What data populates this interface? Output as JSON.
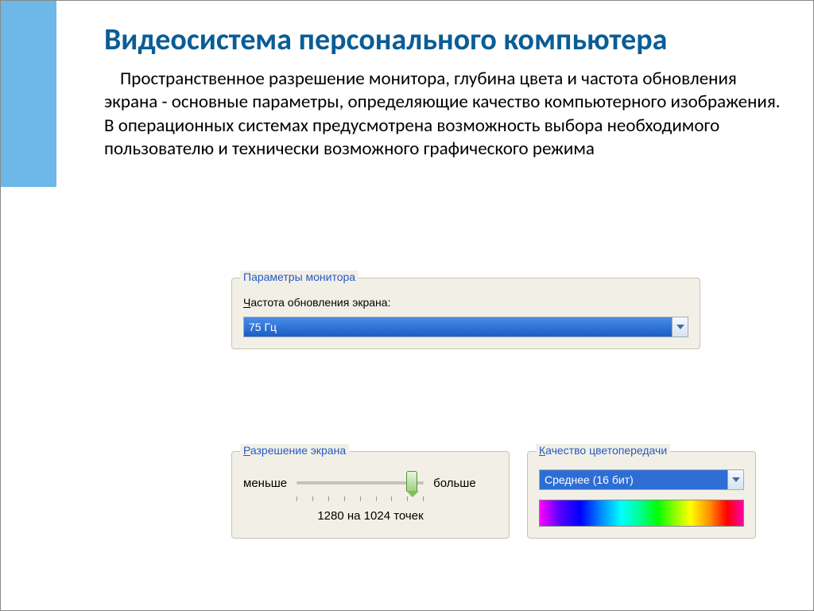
{
  "title": "Видеосистема персонального компьютера",
  "paragraph": "Пространственное разрешение монитора, глубина цвета и частота обновления экрана - основные параметры, определяющие качество компьютерного изображения. В операционных системах предусмотрена возможность выбора необходимого пользователю и технически возможного графического режима",
  "monitor": {
    "legend": "Параметры монитора",
    "refresh_label": "Частота обновления экрана:",
    "refresh_value": "75 Гц"
  },
  "resolution": {
    "legend": "Разрешение экрана",
    "less": "меньше",
    "more": "больше",
    "value": "1280 на 1024 точек"
  },
  "quality": {
    "legend": "Качество цветопередачи",
    "value": "Среднее (16 бит)"
  }
}
